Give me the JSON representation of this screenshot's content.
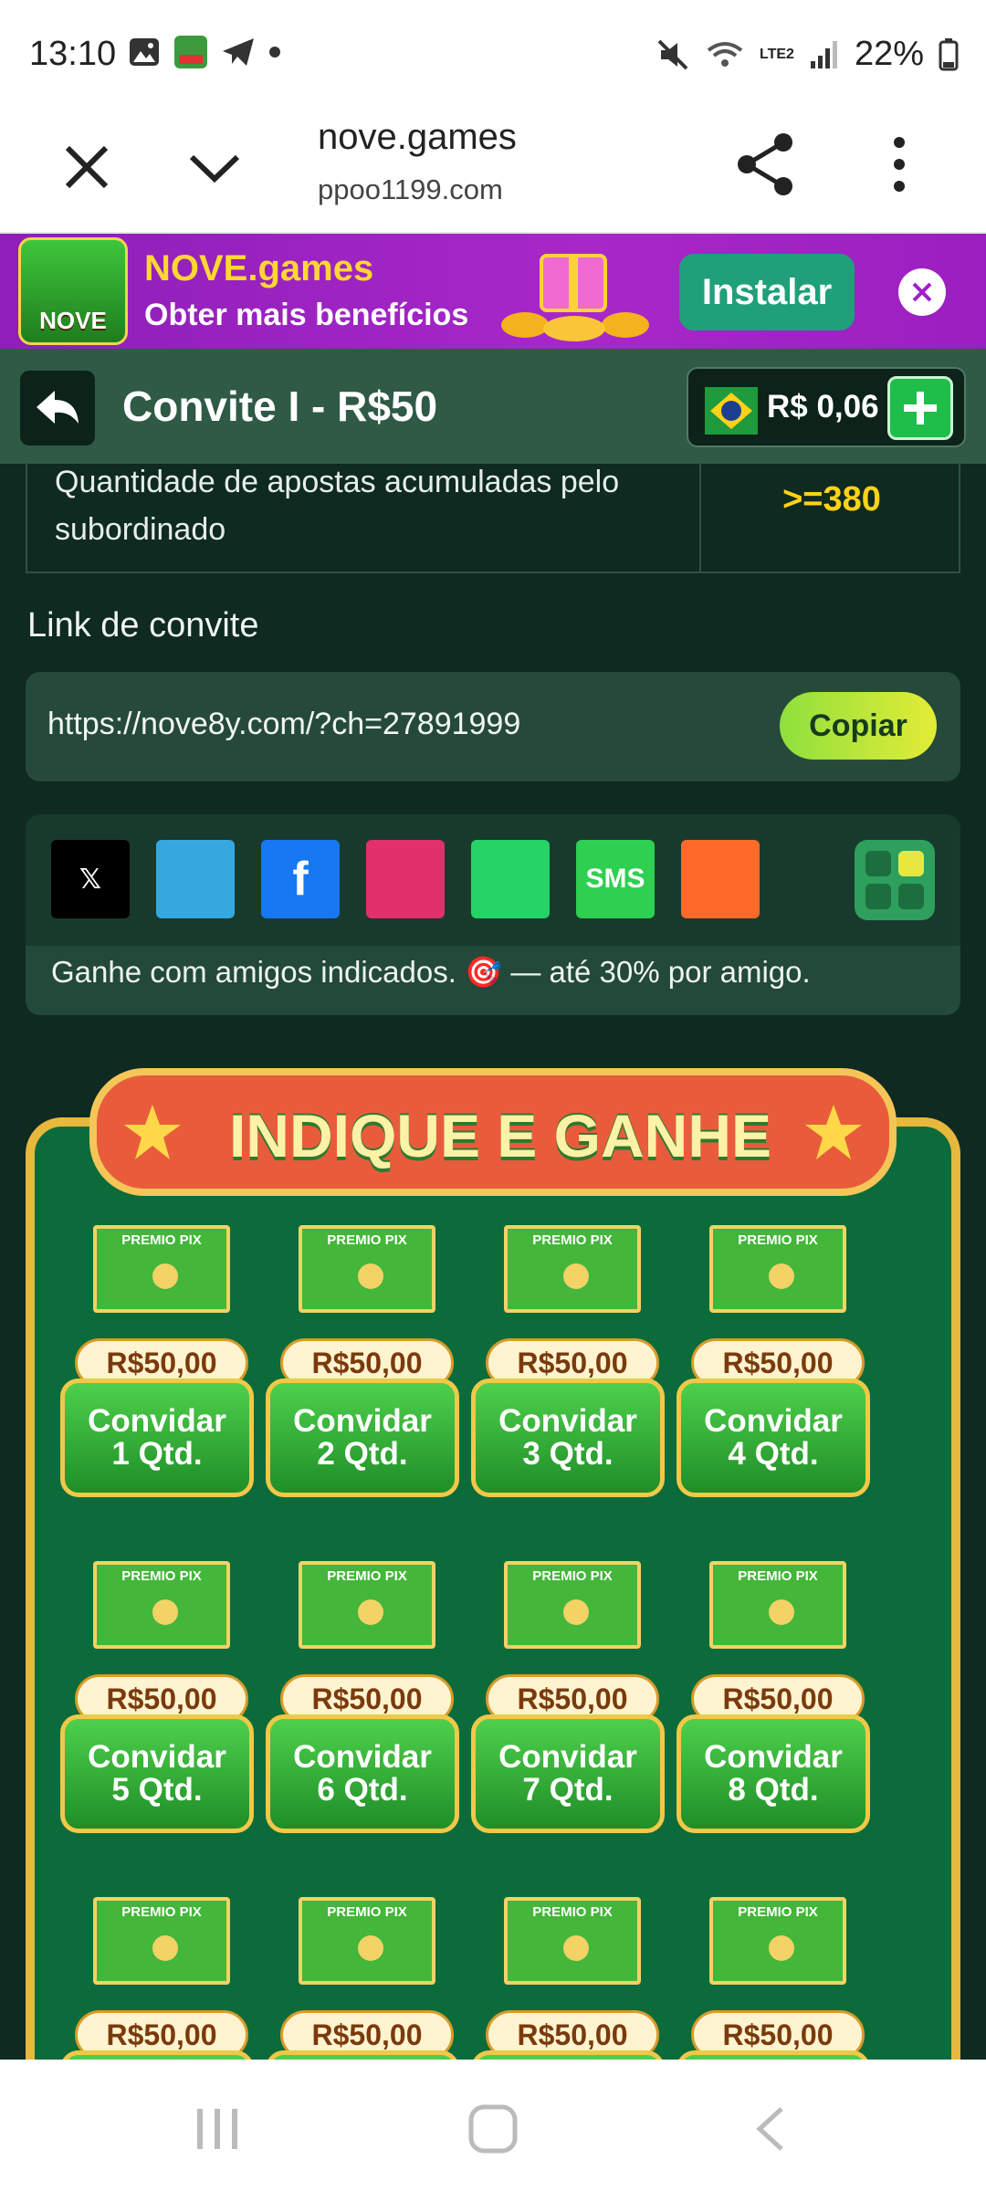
{
  "status_bar": {
    "time": "13:10",
    "network": "LTE2",
    "battery": "22%"
  },
  "browser": {
    "domain": "nove.games",
    "url": "ppoo1199.com"
  },
  "install_banner": {
    "title": "NOVE.games",
    "subtitle": "Obter mais benefícios",
    "install_label": "Instalar",
    "logo_text": "NOVE"
  },
  "header": {
    "title": "Convite I - R$50",
    "balance": "R$ 0,06"
  },
  "requirement": {
    "label": "Quantidade de apostas acumuladas pelo subordinado",
    "value": ">=380"
  },
  "invite": {
    "label": "Link de convite",
    "link": "https://nove8y.com/?ch=27891999",
    "copy_label": "Copiar"
  },
  "share": {
    "icons": [
      {
        "name": "x-icon",
        "text": "𝕏",
        "color": "#000000"
      },
      {
        "name": "telegram-icon",
        "text": "",
        "color": "#35a8e0"
      },
      {
        "name": "facebook-icon",
        "text": "f",
        "color": "#1877f2"
      },
      {
        "name": "instagram-icon",
        "text": "",
        "color": "#e1306c"
      },
      {
        "name": "whatsapp-icon",
        "text": "",
        "color": "#25d366"
      },
      {
        "name": "sms-icon",
        "text": "SMS",
        "color": "#2fcf52"
      },
      {
        "name": "kwai-icon",
        "text": "",
        "color": "#ff6a2b"
      }
    ],
    "note": "Ganhe com amigos indicados. 🎯 — até 30% por amigo."
  },
  "promo": {
    "title": "INDIQUE E GANHE",
    "envelope_label": "PREMIO PIX",
    "cards": [
      {
        "amount": "R$50,00",
        "line1": "Convidar",
        "line2": "1 Qtd."
      },
      {
        "amount": "R$50,00",
        "line1": "Convidar",
        "line2": "2 Qtd."
      },
      {
        "amount": "R$50,00",
        "line1": "Convidar",
        "line2": "3 Qtd."
      },
      {
        "amount": "R$50,00",
        "line1": "Convidar",
        "line2": "4 Qtd."
      },
      {
        "amount": "R$50,00",
        "line1": "Convidar",
        "line2": "5 Qtd."
      },
      {
        "amount": "R$50,00",
        "line1": "Convidar",
        "line2": "6 Qtd."
      },
      {
        "amount": "R$50,00",
        "line1": "Convidar",
        "line2": "7 Qtd."
      },
      {
        "amount": "R$50,00",
        "line1": "Convidar",
        "line2": "8 Qtd."
      },
      {
        "amount": "R$50,00",
        "line1": "",
        "line2": ""
      },
      {
        "amount": "R$50,00",
        "line1": "",
        "line2": ""
      },
      {
        "amount": "R$50,00",
        "line1": "",
        "line2": ""
      },
      {
        "amount": "R$50,00",
        "line1": "",
        "line2": ""
      }
    ]
  }
}
